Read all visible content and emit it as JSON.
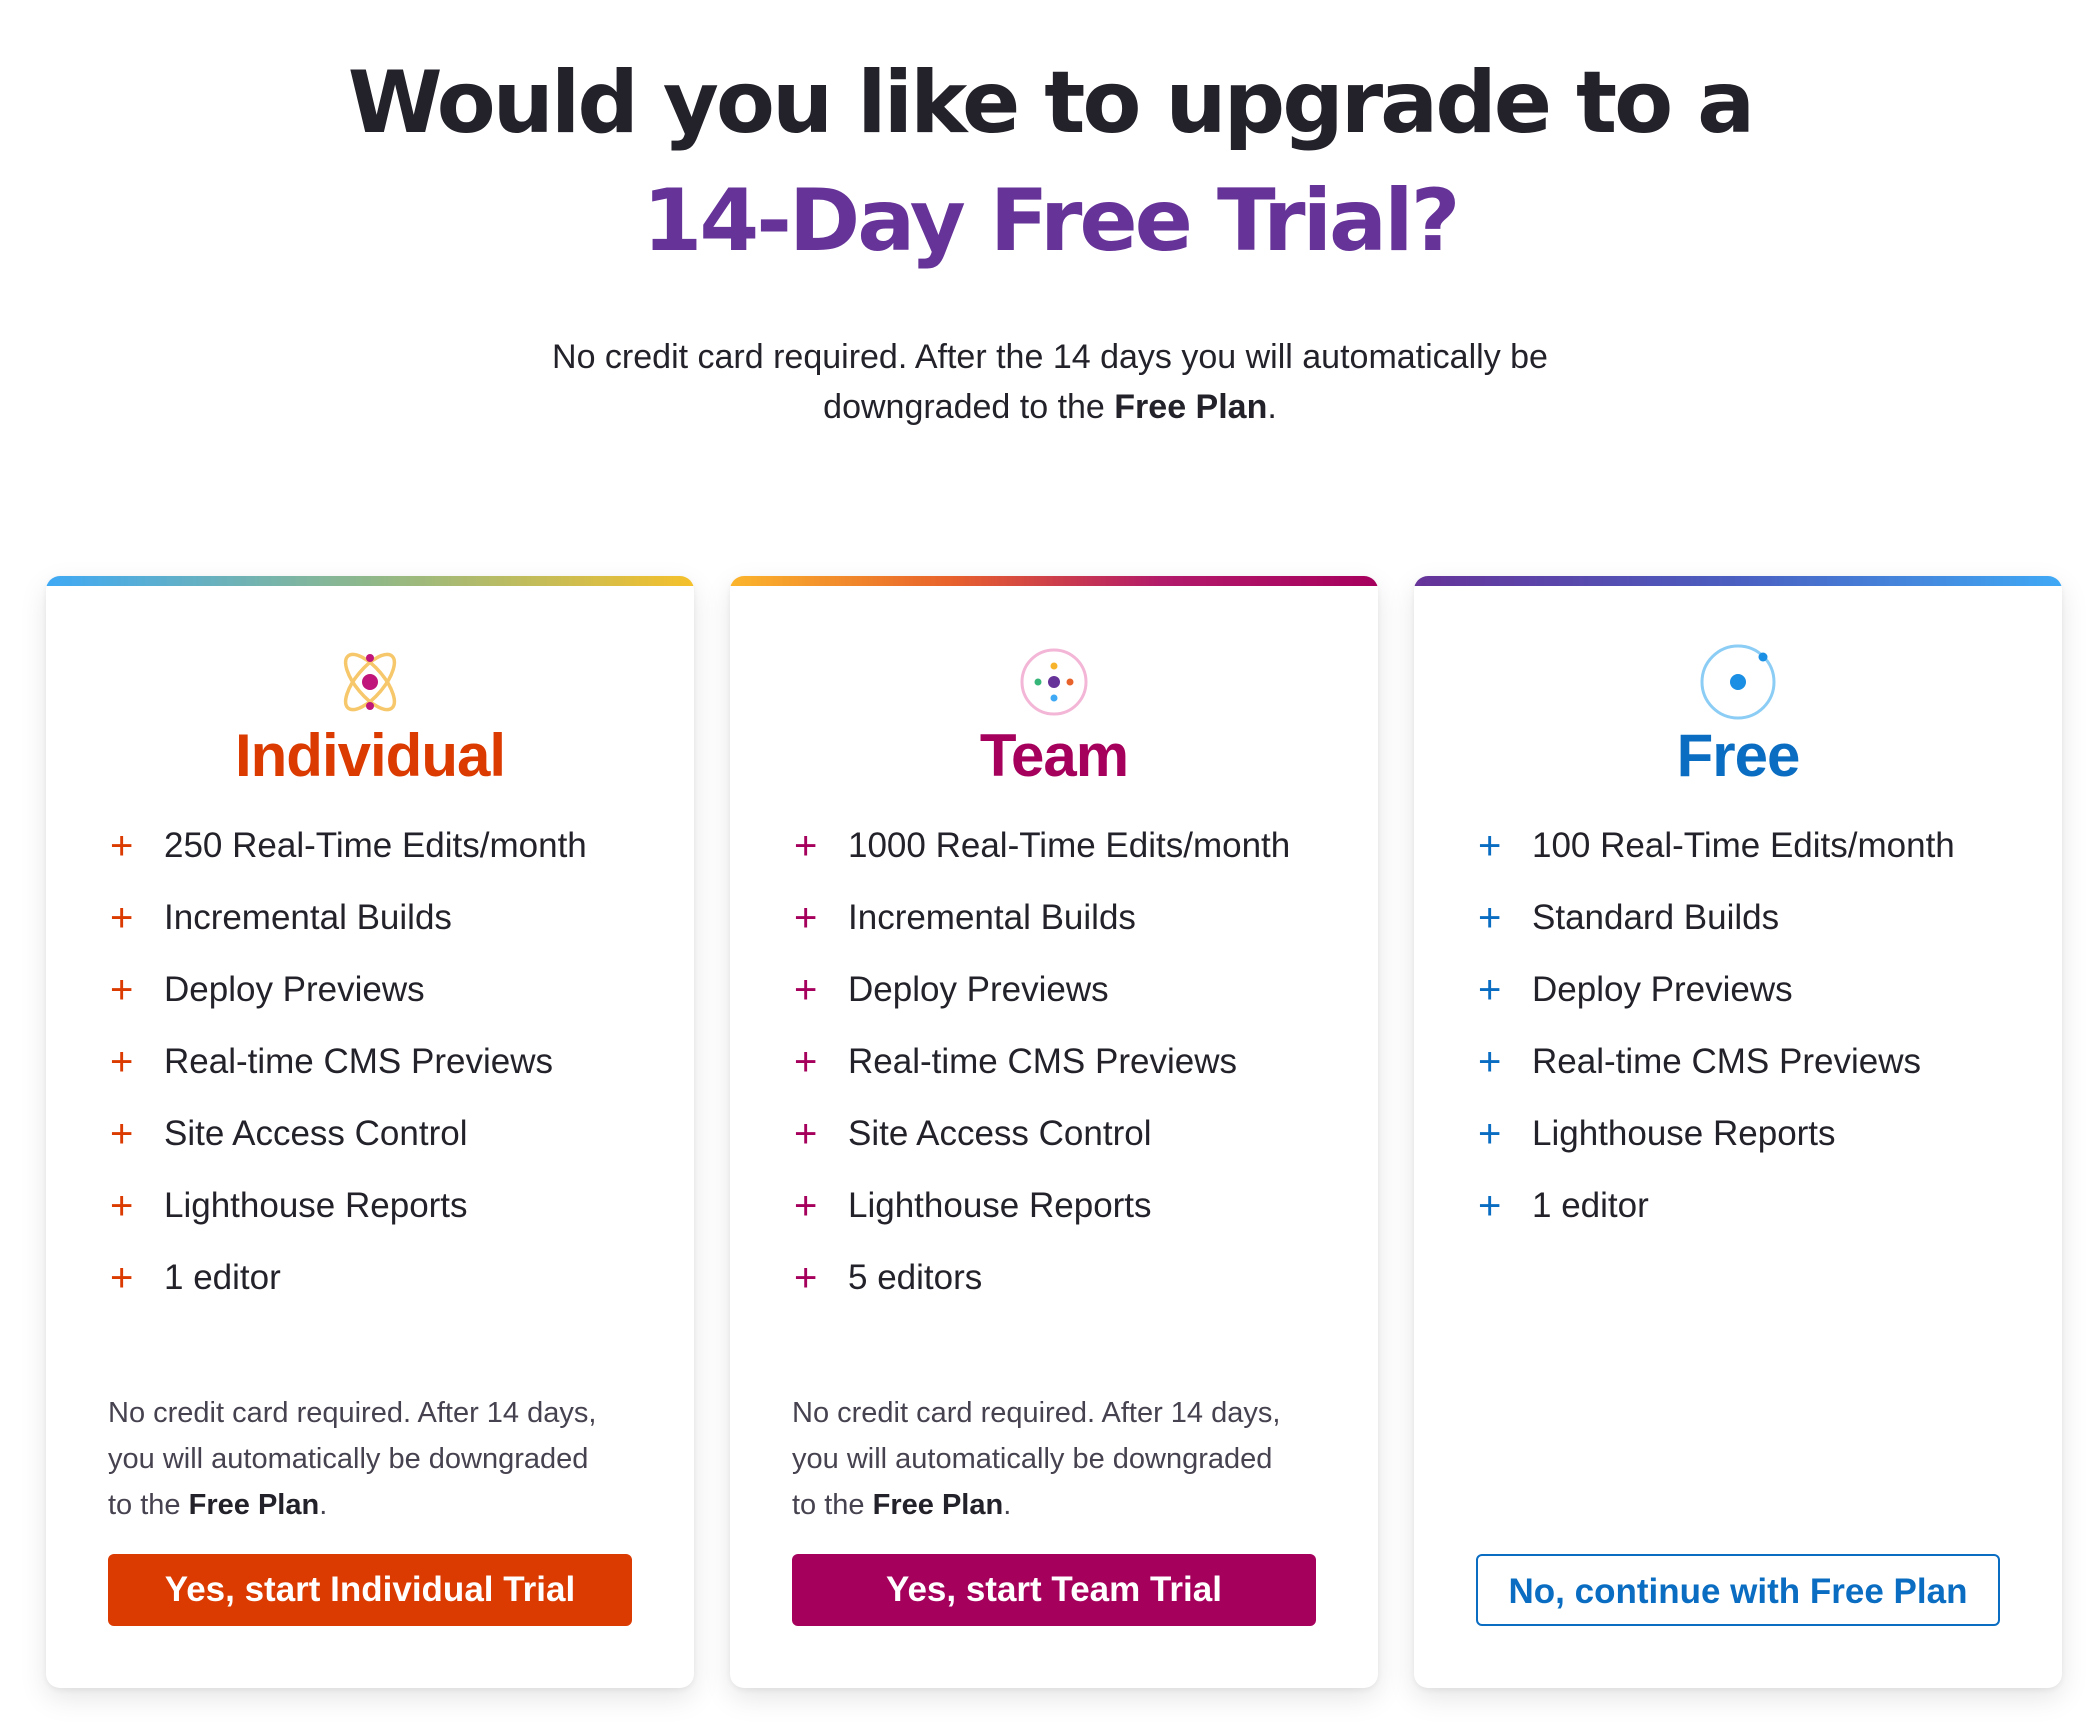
{
  "hero": {
    "headline_line1": "Would you like to upgrade to a",
    "headline_line2": "14-Day Free Trial?",
    "subtitle_part1": "No credit card required. After the 14 days you will automatically be",
    "subtitle_part2": "downgraded to the ",
    "subtitle_bold": "Free Plan",
    "subtitle_part3": "."
  },
  "colors": {
    "headline": "#232129",
    "accent_purple": "#663399",
    "individual": "#db3a00",
    "team": "#a6005d",
    "free": "#0a6dc2"
  },
  "plans": [
    {
      "icon": "atom-icon",
      "title": "Individual",
      "features": [
        "250 Real-Time Edits/month",
        "Incremental Builds",
        "Deploy Previews",
        "Real-time CMS Previews",
        "Site Access Control",
        "Lighthouse Reports",
        "1 editor"
      ],
      "note_part1": "No credit card required. After 14 days, you will automatically be downgraded to the ",
      "note_bold": "Free Plan",
      "note_part2": ".",
      "button_label": "Yes, start Individual Trial"
    },
    {
      "icon": "team-dots-icon",
      "title": "Team",
      "features": [
        "1000 Real-Time Edits/month",
        "Incremental Builds",
        "Deploy Previews",
        "Real-time CMS Previews",
        "Site Access Control",
        "Lighthouse Reports",
        "5 editors"
      ],
      "note_part1": "No credit card required. After 14 days, you will automatically be downgraded to the ",
      "note_bold": "Free Plan",
      "note_part2": ".",
      "button_label": "Yes, start Team Trial"
    },
    {
      "icon": "orbit-icon",
      "title": "Free",
      "features": [
        "100 Real-Time Edits/month",
        "Standard Builds",
        "Deploy Previews",
        "Real-time CMS Previews",
        "Lighthouse Reports",
        "1 editor"
      ],
      "button_label": "No, continue with Free Plan"
    }
  ]
}
